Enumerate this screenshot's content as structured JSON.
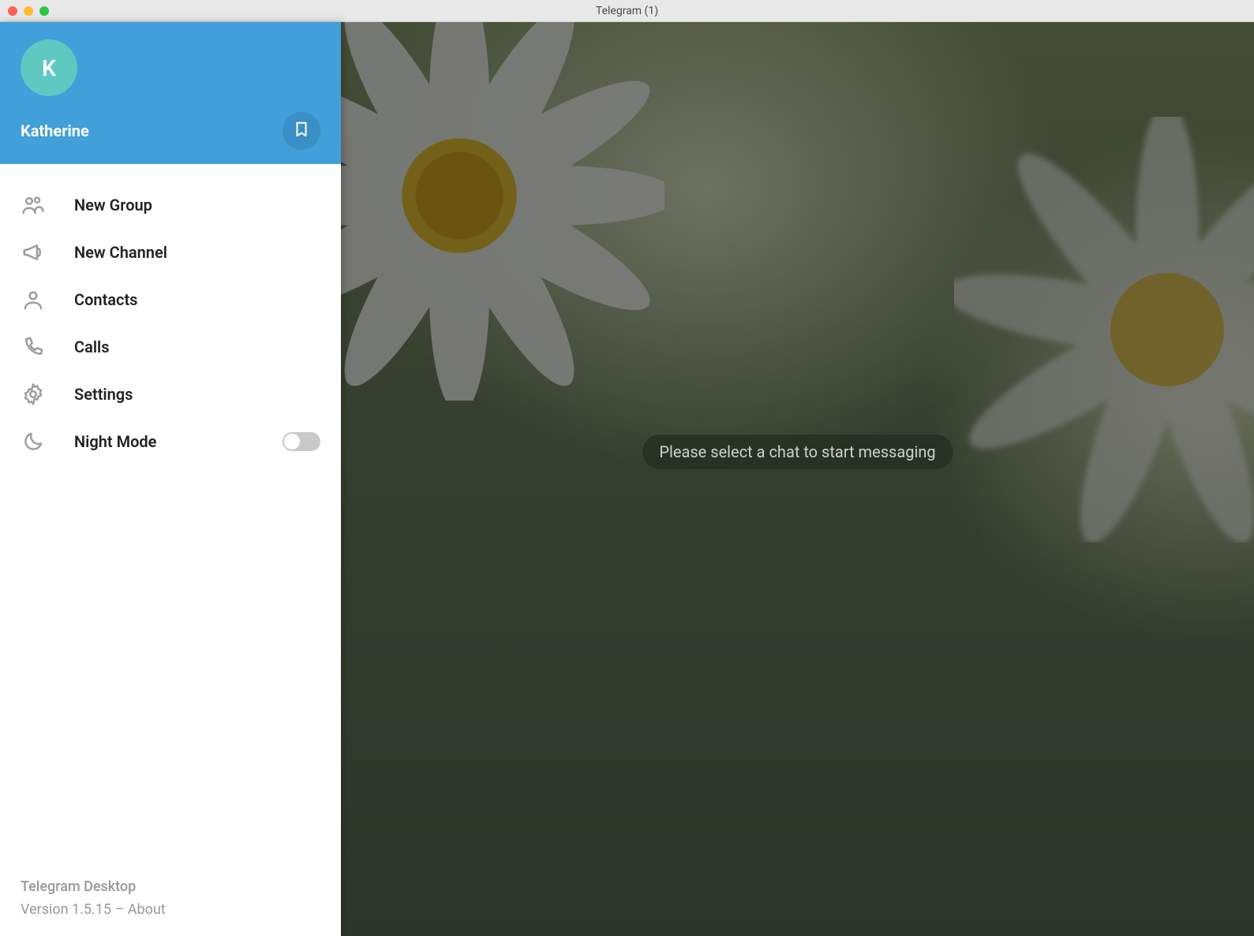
{
  "window": {
    "title": "Telegram (1)"
  },
  "profile": {
    "avatar_letter": "K",
    "username": "Katherine"
  },
  "menu": {
    "new_group": "New Group",
    "new_channel": "New Channel",
    "contacts": "Contacts",
    "calls": "Calls",
    "settings": "Settings",
    "night_mode": "Night Mode"
  },
  "footer": {
    "app_name": "Telegram Desktop",
    "version_line": "Version 1.5.15 – About"
  },
  "main": {
    "placeholder": "Please select a chat to start messaging"
  },
  "colors": {
    "brand_blue": "#419fd9",
    "avatar_teal": "#5fc9c1"
  }
}
